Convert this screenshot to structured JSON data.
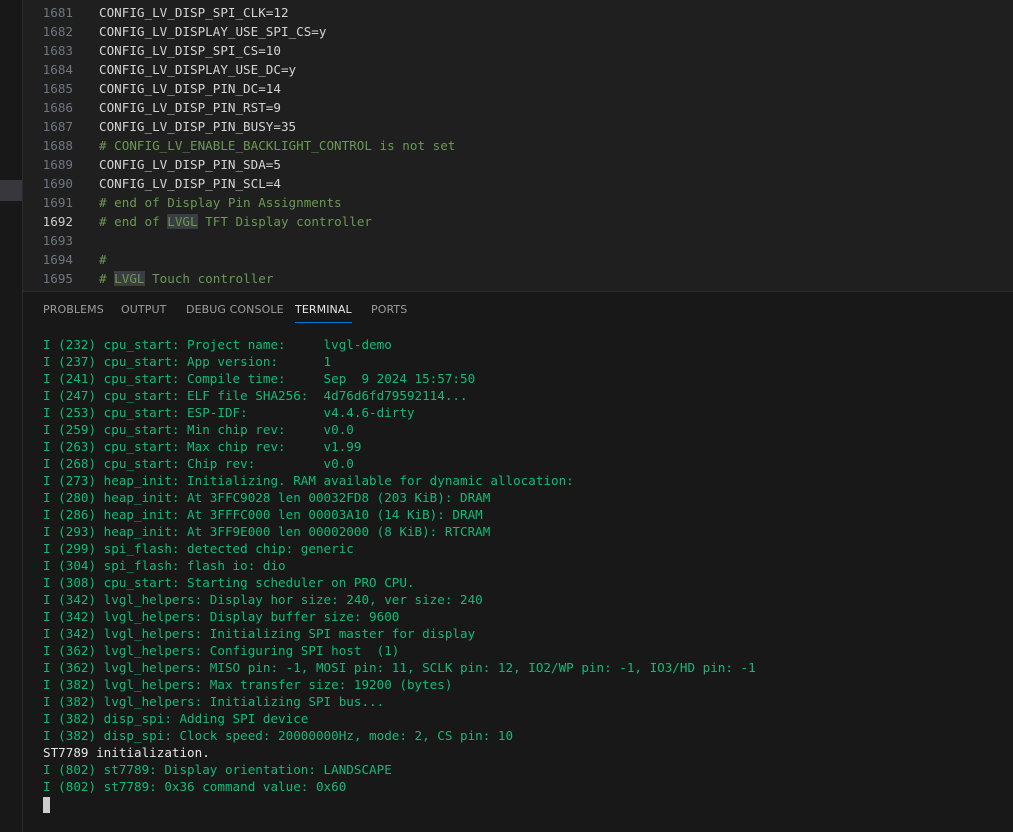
{
  "editor": {
    "current_line": 1692,
    "lines": [
      {
        "num": "1681",
        "text": "CONFIG_LV_DISP_SPI_CLK=12",
        "type": "setting"
      },
      {
        "num": "1682",
        "text": "CONFIG_LV_DISPLAY_USE_SPI_CS=y",
        "type": "setting"
      },
      {
        "num": "1683",
        "text": "CONFIG_LV_DISP_SPI_CS=10",
        "type": "setting"
      },
      {
        "num": "1684",
        "text": "CONFIG_LV_DISPLAY_USE_DC=y",
        "type": "setting"
      },
      {
        "num": "1685",
        "text": "CONFIG_LV_DISP_PIN_DC=14",
        "type": "setting"
      },
      {
        "num": "1686",
        "text": "CONFIG_LV_DISP_PIN_RST=9",
        "type": "setting"
      },
      {
        "num": "1687",
        "text": "CONFIG_LV_DISP_PIN_BUSY=35",
        "type": "setting"
      },
      {
        "num": "1688",
        "text": "# CONFIG_LV_ENABLE_BACKLIGHT_CONTROL is not set",
        "type": "comment"
      },
      {
        "num": "1689",
        "text": "CONFIG_LV_DISP_PIN_SDA=5",
        "type": "setting"
      },
      {
        "num": "1690",
        "text": "CONFIG_LV_DISP_PIN_SCL=4",
        "type": "setting"
      },
      {
        "num": "1691",
        "text": "# end of Display Pin Assignments",
        "type": "comment"
      },
      {
        "num": "1692",
        "text": "# end of LVGL TFT Display controller",
        "type": "comment",
        "highlight": "LVGL"
      },
      {
        "num": "1693",
        "text": "",
        "type": "blank"
      },
      {
        "num": "1694",
        "text": "#",
        "type": "comment"
      },
      {
        "num": "1695",
        "text": "# LVGL Touch controller",
        "type": "comment",
        "highlight": "LVGL"
      }
    ]
  },
  "panel": {
    "tabs": [
      {
        "label": "PROBLEMS",
        "active": false
      },
      {
        "label": "OUTPUT",
        "active": false
      },
      {
        "label": "DEBUG CONSOLE",
        "active": false
      },
      {
        "label": "TERMINAL",
        "active": true
      },
      {
        "label": "PORTS",
        "active": false
      }
    ]
  },
  "terminal": {
    "colors": {
      "log": "#0dbc79",
      "plain": "#e5e5e5"
    },
    "lines": [
      {
        "text": "I (232) cpu_start: Project name:     lvgl-demo",
        "kind": "log"
      },
      {
        "text": "I (237) cpu_start: App version:      1",
        "kind": "log"
      },
      {
        "text": "I (241) cpu_start: Compile time:     Sep  9 2024 15:57:50",
        "kind": "log"
      },
      {
        "text": "I (247) cpu_start: ELF file SHA256:  4d76d6fd79592114...",
        "kind": "log"
      },
      {
        "text": "I (253) cpu_start: ESP-IDF:          v4.4.6-dirty",
        "kind": "log"
      },
      {
        "text": "I (259) cpu_start: Min chip rev:     v0.0",
        "kind": "log"
      },
      {
        "text": "I (263) cpu_start: Max chip rev:     v1.99",
        "kind": "log"
      },
      {
        "text": "I (268) cpu_start: Chip rev:         v0.0",
        "kind": "log"
      },
      {
        "text": "I (273) heap_init: Initializing. RAM available for dynamic allocation:",
        "kind": "log"
      },
      {
        "text": "I (280) heap_init: At 3FFC9028 len 00032FD8 (203 KiB): DRAM",
        "kind": "log"
      },
      {
        "text": "I (286) heap_init: At 3FFFC000 len 00003A10 (14 KiB): DRAM",
        "kind": "log"
      },
      {
        "text": "I (293) heap_init: At 3FF9E000 len 00002000 (8 KiB): RTCRAM",
        "kind": "log"
      },
      {
        "text": "I (299) spi_flash: detected chip: generic",
        "kind": "log"
      },
      {
        "text": "I (304) spi_flash: flash io: dio",
        "kind": "log"
      },
      {
        "text": "I (308) cpu_start: Starting scheduler on PRO CPU.",
        "kind": "log"
      },
      {
        "text": "I (342) lvgl_helpers: Display hor size: 240, ver size: 240",
        "kind": "log"
      },
      {
        "text": "I (342) lvgl_helpers: Display buffer size: 9600",
        "kind": "log"
      },
      {
        "text": "I (342) lvgl_helpers: Initializing SPI master for display",
        "kind": "log"
      },
      {
        "text": "I (362) lvgl_helpers: Configuring SPI host  (1)",
        "kind": "log"
      },
      {
        "text": "I (362) lvgl_helpers: MISO pin: -1, MOSI pin: 11, SCLK pin: 12, IO2/WP pin: -1, IO3/HD pin: -1",
        "kind": "log"
      },
      {
        "text": "I (382) lvgl_helpers: Max transfer size: 19200 (bytes)",
        "kind": "log"
      },
      {
        "text": "I (382) lvgl_helpers: Initializing SPI bus...",
        "kind": "log"
      },
      {
        "text": "I (382) disp_spi: Adding SPI device",
        "kind": "log"
      },
      {
        "text": "I (382) disp_spi: Clock speed: 20000000Hz, mode: 2, CS pin: 10",
        "kind": "log"
      },
      {
        "text": "ST7789 initialization.",
        "kind": "plain"
      },
      {
        "text": "I (802) st7789: Display orientation: LANDSCAPE",
        "kind": "log"
      },
      {
        "text": "I (802) st7789: 0x36 command value: 0x60",
        "kind": "log"
      }
    ]
  }
}
